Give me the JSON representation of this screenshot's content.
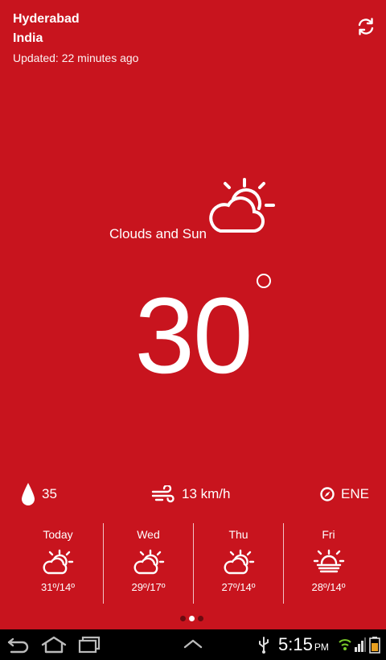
{
  "location": {
    "city": "Hyderabad",
    "country": "India",
    "updated": "Updated: 22 minutes ago"
  },
  "current": {
    "condition": "Clouds and Sun",
    "condition_icon": "clouds-and-sun-icon",
    "temperature": "30",
    "humidity": "35",
    "wind_speed": "13 km/h",
    "wind_direction": "ENE"
  },
  "forecast": [
    {
      "day": "Today",
      "icon": "partly-cloudy-icon",
      "temps": "31º/14º"
    },
    {
      "day": "Wed",
      "icon": "partly-cloudy-icon",
      "temps": "29º/17º"
    },
    {
      "day": "Thu",
      "icon": "partly-cloudy-icon",
      "temps": "27º/14º"
    },
    {
      "day": "Fri",
      "icon": "haze-sun-icon",
      "temps": "28º/14º"
    }
  ],
  "pager": {
    "pages": 3,
    "active": 2
  },
  "status_bar": {
    "time": "5:15",
    "ampm": "PM"
  },
  "colors": {
    "background": "#c8141e",
    "foreground": "#ffffff",
    "navbar": "#000000"
  }
}
